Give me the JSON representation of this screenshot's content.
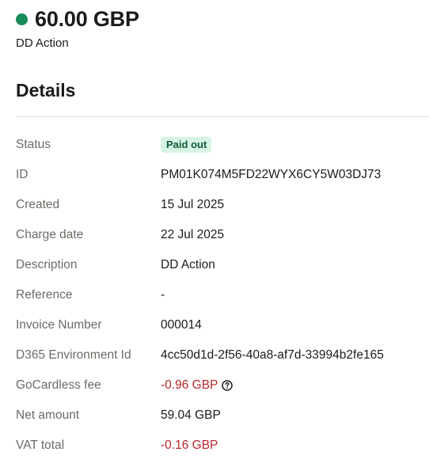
{
  "payment": {
    "amount": "60.00 GBP",
    "description": "DD Action",
    "status_color": "#1b8a5a"
  },
  "details": {
    "title": "Details",
    "rows": [
      {
        "label": "Status",
        "value": "Paid out",
        "type": "badge"
      },
      {
        "label": "ID",
        "value": "PM01K074M5FD22WYX6CY5W03DJ73"
      },
      {
        "label": "Created",
        "value": "15 Jul 2025"
      },
      {
        "label": "Charge date",
        "value": "22 Jul 2025"
      },
      {
        "label": "Description",
        "value": "DD Action"
      },
      {
        "label": "Reference",
        "value": "-"
      },
      {
        "label": "Invoice Number",
        "value": "000014"
      },
      {
        "label": "D365 Environment Id",
        "value": "4cc50d1d-2f56-40a8-af7d-33994b2fe165"
      },
      {
        "label": "GoCardless fee",
        "value": "-0.96 GBP",
        "type": "negative",
        "help_icon": "question-circle-icon"
      },
      {
        "label": "Net amount",
        "value": "59.04 GBP"
      },
      {
        "label": "VAT total",
        "value": "-0.16 GBP",
        "type": "negative"
      }
    ]
  },
  "colors": {
    "negative": "#b8262b",
    "badge_bg": "#d7f3e3",
    "badge_text": "#0f5c39",
    "label": "#6e6b66"
  }
}
